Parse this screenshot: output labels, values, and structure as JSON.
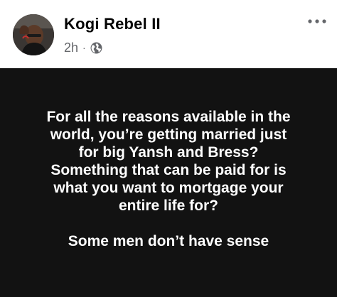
{
  "post": {
    "author": "Kogi Rebel II",
    "time": "2h",
    "separator": "·",
    "privacy_icon": "globe-icon",
    "more_icon": "more-horizontal-icon",
    "lines": [
      "For all the reasons available in the",
      "world, you’re getting married just",
      "for big Yansh and Bress?",
      "Something that can be paid for is",
      "what you want to mortgage your",
      "entire life for?"
    ],
    "closing": "Some men don’t have sense"
  },
  "colors": {
    "post_background": "#121212",
    "post_text": "#ffffff",
    "author_text": "#050505",
    "meta_text": "#65676b"
  }
}
